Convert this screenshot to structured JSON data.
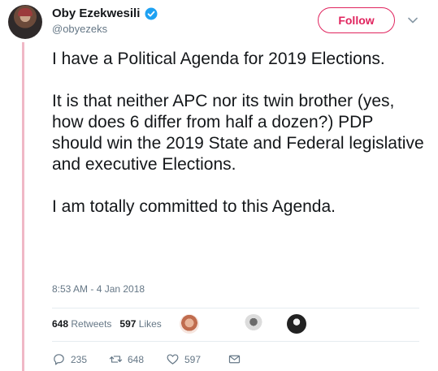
{
  "user": {
    "display_name": "Oby Ezekwesili",
    "handle": "@obyezeks",
    "verified": true
  },
  "follow_button": {
    "label": "Follow"
  },
  "tweet": {
    "paragraphs": [
      "I have a Political Agenda for 2019 Elections.",
      "It is that neither APC nor its twin brother (yes, how does 6 differ from half a dozen?) PDP should win the 2019 State and Federal legislative and executive Elections.",
      "I am totally committed to this Agenda."
    ],
    "timestamp": "8:53 AM - 4 Jan 2018"
  },
  "stats": {
    "retweets_count": "648",
    "retweets_label": "Retweets",
    "likes_count": "597",
    "likes_label": "Likes"
  },
  "actions": {
    "reply_count": "235",
    "retweet_count": "648",
    "like_count": "597"
  },
  "colors": {
    "accent": "#e0245e",
    "verified": "#1da1f2",
    "muted": "#657786",
    "thread_line": "#f0b8c6"
  }
}
